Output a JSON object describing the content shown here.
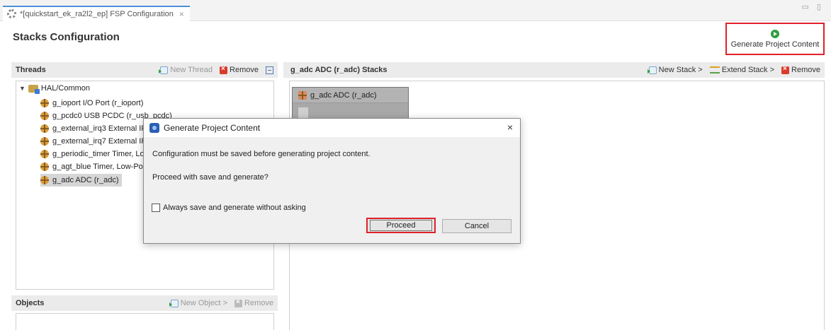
{
  "editor": {
    "tab_label": "*[quickstart_ek_ra2l2_ep] FSP Configuration",
    "tab_close": "×",
    "window_controls": "▭ ▯"
  },
  "header": {
    "title": "Stacks Configuration",
    "generate_button": "Generate Project Content"
  },
  "threads": {
    "title": "Threads",
    "new_thread": "New Thread",
    "remove": "Remove",
    "tree_root": "HAL/Common",
    "items": [
      {
        "label": "g_ioport I/O Port (r_ioport)"
      },
      {
        "label": "g_pcdc0 USB PCDC (r_usb_pcdc)"
      },
      {
        "label": "g_external_irq3 External IR"
      },
      {
        "label": "g_external_irq7 External IR"
      },
      {
        "label": "g_periodic_timer Timer, Lo"
      },
      {
        "label": "g_agt_blue Timer, Low-Po"
      },
      {
        "label": "g_adc ADC (r_adc)"
      }
    ]
  },
  "stacks": {
    "title": "g_adc ADC (r_adc) Stacks",
    "new_stack": "New Stack >",
    "extend_stack": "Extend Stack >",
    "remove": "Remove",
    "block_label": "g_adc ADC (r_adc)"
  },
  "objects": {
    "title": "Objects",
    "new_object": "New Object >",
    "remove": "Remove"
  },
  "dialog": {
    "title": "Generate Project Content",
    "close": "×",
    "message1": "Configuration must be saved before generating project content.",
    "message2": "Proceed with save and generate?",
    "checkbox_label": "Always save and generate without asking",
    "checkbox_checked": false,
    "proceed": "Proceed",
    "cancel": "Cancel"
  },
  "colors": {
    "highlight_red": "#e0202a",
    "generate_green": "#2e9e3e",
    "panel_header": "#ebebeb"
  }
}
